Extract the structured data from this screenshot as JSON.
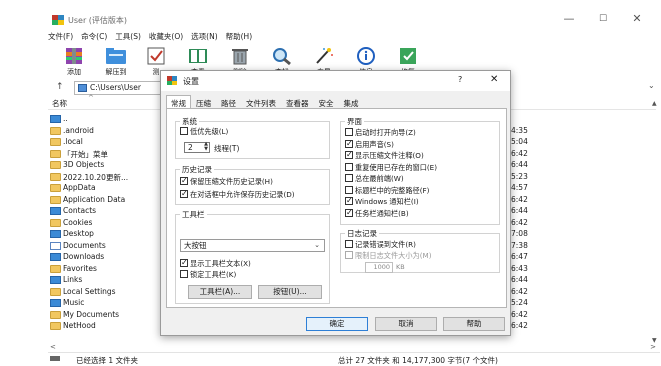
{
  "window": {
    "title": "User (评估版本)",
    "controls": {
      "minimize": "—",
      "maximize": "☐",
      "close": "✕"
    }
  },
  "menu": [
    "文件(F)",
    "命令(C)",
    "工具(S)",
    "收藏夹(O)",
    "选项(N)",
    "帮助(H)"
  ],
  "toolbar": {
    "add": "添加",
    "extract": "解压到",
    "test": "测",
    "view": "查看",
    "delete": "删除",
    "find": "查找",
    "wizard": "向导",
    "info": "信息",
    "repair": "修复"
  },
  "address": {
    "path": "C:\\Users\\User"
  },
  "list": {
    "column_name": "名称",
    "items": [
      {
        "name": "..",
        "icon": "folder-up-icon",
        "time": ""
      },
      {
        "name": ".android",
        "icon": "folder-icon",
        "time": "4:35"
      },
      {
        "name": ".local",
        "icon": "folder-icon",
        "time": "5:04"
      },
      {
        "name": "「开始」菜单",
        "icon": "folder-icon",
        "time": "6:42"
      },
      {
        "name": "3D Objects",
        "icon": "folder-icon",
        "time": "6:44"
      },
      {
        "name": "2022.10.20更新...",
        "icon": "folder-icon",
        "time": "5:23"
      },
      {
        "name": "AppData",
        "icon": "folder-icon",
        "time": "4:57"
      },
      {
        "name": "Application Data",
        "icon": "folder-icon",
        "time": "6:42"
      },
      {
        "name": "Contacts",
        "icon": "contacts-icon",
        "time": "6:44"
      },
      {
        "name": "Cookies",
        "icon": "folder-icon",
        "time": "6:42"
      },
      {
        "name": "Desktop",
        "icon": "desktop-icon",
        "time": "7:08"
      },
      {
        "name": "Documents",
        "icon": "documents-icon",
        "time": "7:38"
      },
      {
        "name": "Downloads",
        "icon": "downloads-icon",
        "time": "6:47"
      },
      {
        "name": "Favorites",
        "icon": "favorites-icon",
        "time": "6:43"
      },
      {
        "name": "Links",
        "icon": "links-icon",
        "time": "6:44"
      },
      {
        "name": "Local Settings",
        "icon": "folder-icon",
        "time": "6:42"
      },
      {
        "name": "Music",
        "icon": "music-icon",
        "time": "5:24"
      },
      {
        "name": "My Documents",
        "icon": "folder-icon",
        "time": "6:42"
      },
      {
        "name": "NetHood",
        "icon": "folder-icon",
        "time": "6:42"
      }
    ]
  },
  "status": {
    "selected": "已经选择 1 文件夹",
    "total": "总计 27 文件夹 和 14,177,300 字节(7 个文件)"
  },
  "dialog": {
    "title": "设置",
    "help_mark": "?",
    "close": "✕",
    "tabs": [
      "常规",
      "压缩",
      "路径",
      "文件列表",
      "查看器",
      "安全",
      "集成"
    ],
    "active_tab": 0,
    "system": {
      "title": "系统",
      "low_priority": {
        "label": "低优先级(L)",
        "checked": false
      },
      "threads_value": "2",
      "threads_label": "线程(T)"
    },
    "history": {
      "title": "历史记录",
      "keep_history": {
        "label": "保留压缩文件历史记录(H)",
        "checked": true
      },
      "allow_in_dialogs": {
        "label": "在对话框中允许保存历史记录(D)",
        "checked": true
      }
    },
    "toolbar_group": {
      "title": "工具栏",
      "size_selected": "大按钮",
      "show_text": {
        "label": "显示工具栏文本(X)",
        "checked": true
      },
      "lock_toolbar": {
        "label": "锁定工具栏(K)",
        "checked": false
      },
      "toolbar_button": "工具栏(A)...",
      "buttons_button": "按钮(U)..."
    },
    "interface": {
      "title": "界面",
      "items": [
        {
          "label": "启动时打开向导(Z)",
          "checked": false
        },
        {
          "label": "启用声音(S)",
          "checked": true
        },
        {
          "label": "显示压缩文件注释(O)",
          "checked": true
        },
        {
          "label": "重复使用已存在的窗口(E)",
          "checked": false
        },
        {
          "label": "总在最前端(W)",
          "checked": false
        },
        {
          "label": "标题栏中的完整路径(F)",
          "checked": false
        },
        {
          "label": "Windows 通知栏(I)",
          "checked": true
        },
        {
          "label": "任务栏通知栏(B)",
          "checked": true
        }
      ]
    },
    "log": {
      "title": "日志记录",
      "log_errors": {
        "label": "记录错误到文件(R)",
        "checked": false
      },
      "limit_size": {
        "label": "限制日志文件大小为(M)",
        "checked": false
      },
      "size_value": "1000",
      "size_unit": "KB"
    },
    "buttons": {
      "ok": "确定",
      "cancel": "取消",
      "help": "帮助"
    }
  }
}
